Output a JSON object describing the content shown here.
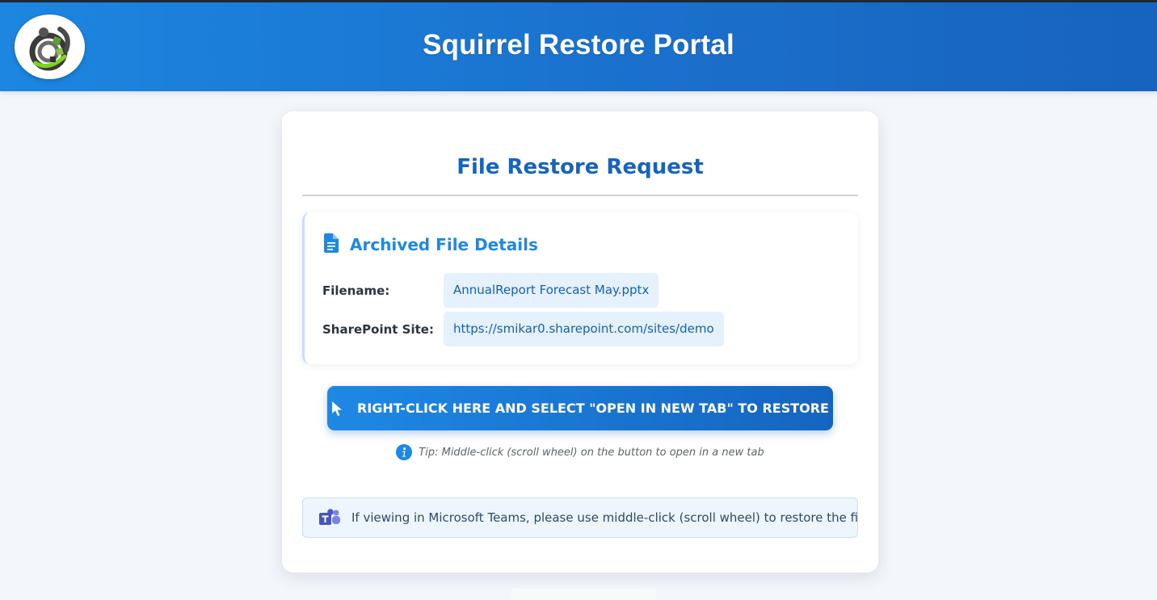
{
  "header": {
    "title": "Squirrel Restore Portal",
    "logo_icon": "squirrel-logo-icon"
  },
  "card": {
    "title": "File Restore Request",
    "details": {
      "heading": "Archived File Details",
      "heading_icon": "document-icon",
      "rows": [
        {
          "label": "Filename:",
          "value": "AnnualReport Forecast May.pptx"
        },
        {
          "label": "SharePoint Site:",
          "value": "https://smikar0.sharepoint.com/sites/demo"
        }
      ]
    },
    "restore_button": {
      "label": "RIGHT-CLICK HERE AND SELECT \"OPEN IN NEW TAB\" TO RESTORE",
      "icon": "mouse-pointer-icon"
    },
    "tip": {
      "text": "Tip: Middle-click (scroll wheel) on the button to open in a new tab",
      "icon": "info-icon"
    },
    "teams_note": {
      "text": "If viewing in Microsoft Teams, please use middle-click (scroll wheel) to restore the file",
      "icon": "microsoft-teams-icon"
    }
  },
  "colors": {
    "header_start": "#1c86e0",
    "header_end": "#1763bd",
    "accent": "#1565c0",
    "value_bg": "#e5f1fd",
    "page_bg": "#f3f6fa"
  }
}
